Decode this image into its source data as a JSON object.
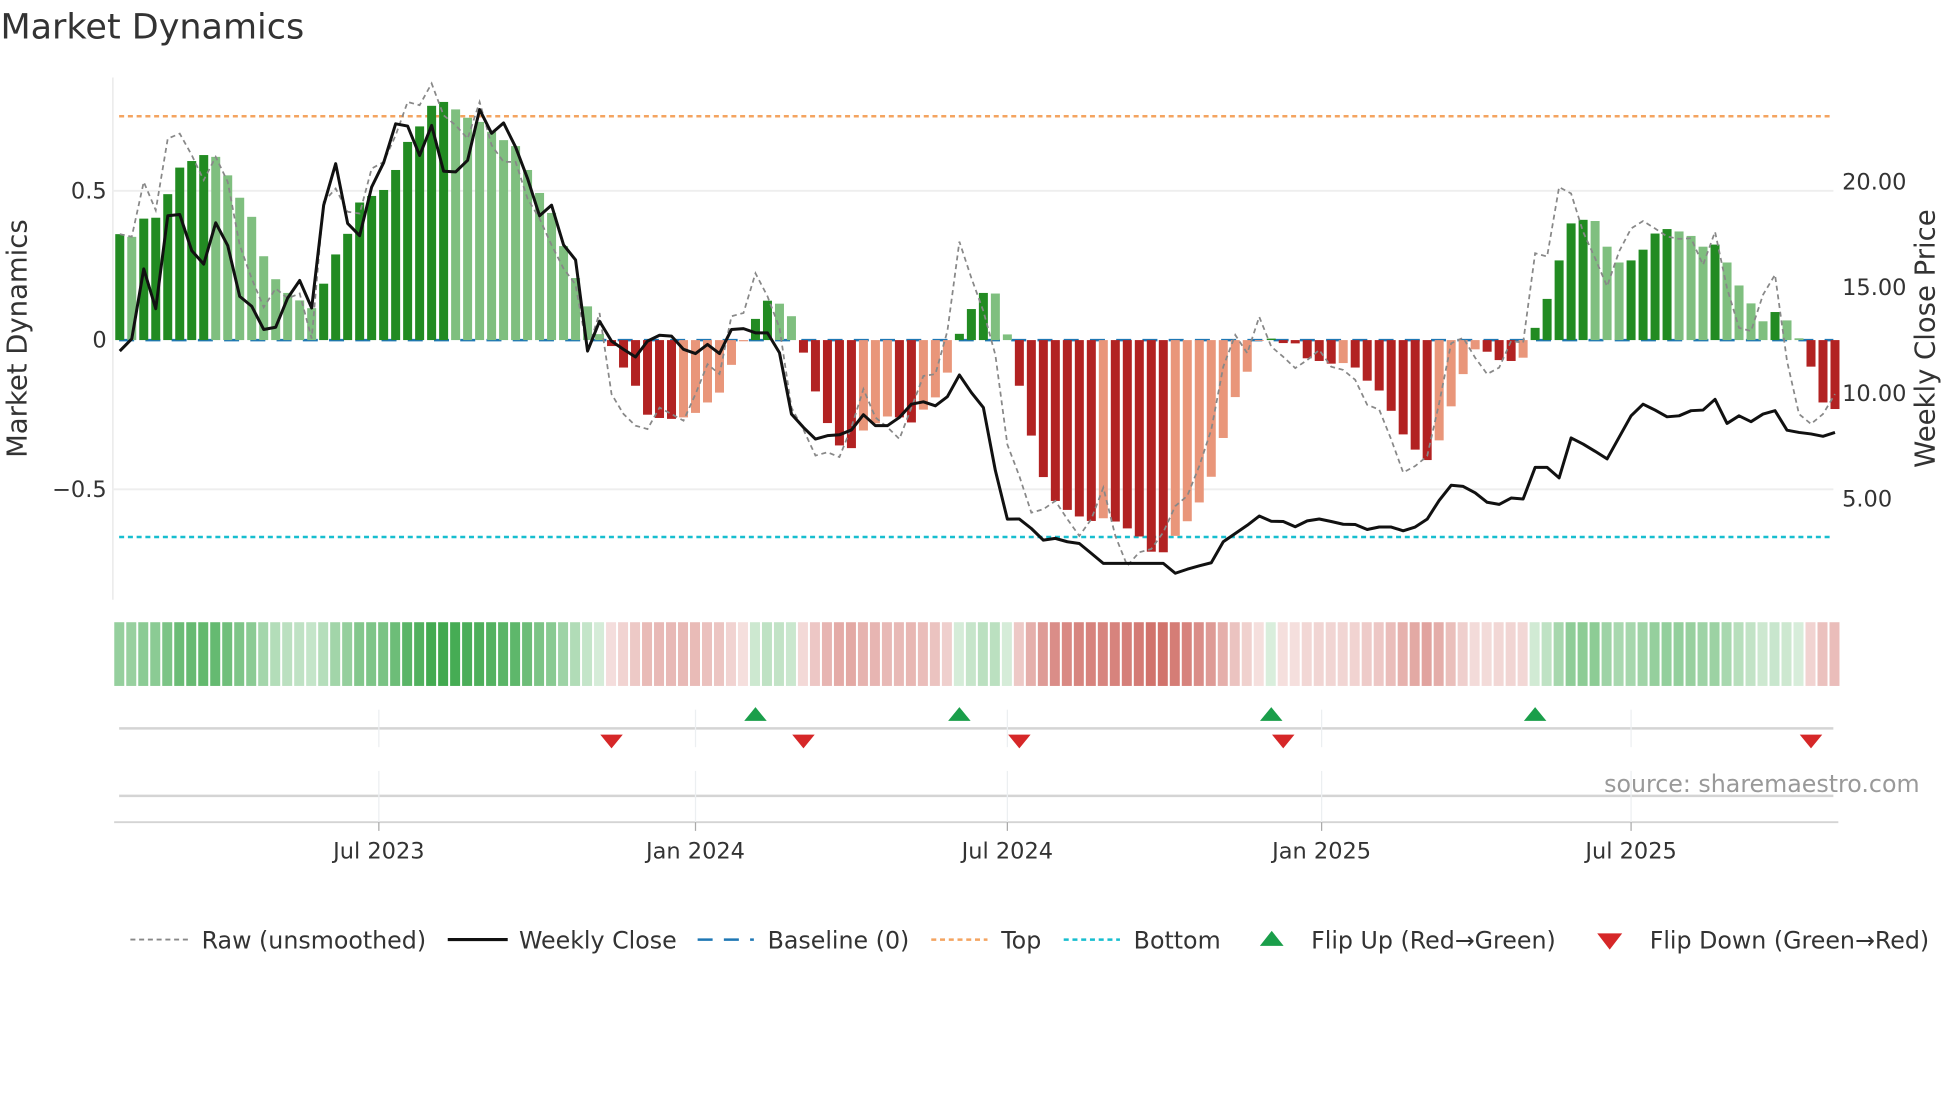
{
  "chart_data": {
    "type": "bar",
    "title": "Market Dynamics",
    "ylabel": "Market Dynamics",
    "y2label": "Weekly Close Price",
    "ylim": [
      -0.87,
      0.88
    ],
    "y2lim": [
      0.24,
      24.94
    ],
    "yticks": [
      {
        "v": 0.5,
        "label": "0.5"
      },
      {
        "v": 0,
        "label": "0"
      },
      {
        "v": -0.5,
        "label": "−0.5"
      }
    ],
    "y2ticks": [
      {
        "v": 20,
        "label": "20.00"
      },
      {
        "v": 15,
        "label": "15.00"
      },
      {
        "v": 10,
        "label": "10.00"
      },
      {
        "v": 5,
        "label": "5.00"
      }
    ],
    "xticks": [
      {
        "pos": 21.6,
        "label": "Jul 2023"
      },
      {
        "pos": 48.0,
        "label": "Jan 2024"
      },
      {
        "pos": 74.0,
        "label": "Jul 2024"
      },
      {
        "pos": 100.2,
        "label": "Jan 2025"
      },
      {
        "pos": 126.0,
        "label": "Jul 2025"
      }
    ],
    "grid": true,
    "top_level": 0.75,
    "bottom_level": -0.66,
    "baseline": 0,
    "momentum": [
      0.355,
      0.346,
      0.407,
      0.41,
      0.489,
      0.578,
      0.6,
      0.62,
      0.614,
      0.552,
      0.477,
      0.413,
      0.281,
      0.204,
      0.158,
      0.133,
      0.107,
      0.189,
      0.287,
      0.356,
      0.461,
      0.483,
      0.503,
      0.57,
      0.664,
      0.716,
      0.785,
      0.798,
      0.773,
      0.745,
      0.731,
      0.698,
      0.67,
      0.65,
      0.57,
      0.493,
      0.426,
      0.315,
      0.208,
      0.113,
      0.02,
      -0.02,
      -0.092,
      -0.153,
      -0.25,
      -0.261,
      -0.264,
      -0.259,
      -0.244,
      -0.209,
      -0.176,
      -0.083,
      -0.004,
      0.071,
      0.132,
      0.122,
      0.08,
      -0.042,
      -0.172,
      -0.278,
      -0.353,
      -0.362,
      -0.303,
      -0.279,
      -0.256,
      -0.259,
      -0.276,
      -0.233,
      -0.192,
      -0.109,
      0.021,
      0.104,
      0.158,
      0.156,
      0.019,
      -0.153,
      -0.32,
      -0.459,
      -0.539,
      -0.569,
      -0.591,
      -0.606,
      -0.597,
      -0.608,
      -0.631,
      -0.658,
      -0.709,
      -0.711,
      -0.656,
      -0.607,
      -0.544,
      -0.458,
      -0.328,
      -0.191,
      -0.106,
      -0.003,
      0.005,
      -0.01,
      -0.011,
      -0.061,
      -0.07,
      -0.079,
      -0.077,
      -0.092,
      -0.136,
      -0.169,
      -0.237,
      -0.316,
      -0.367,
      -0.402,
      -0.336,
      -0.222,
      -0.114,
      -0.031,
      -0.039,
      -0.067,
      -0.07,
      -0.059,
      0.041,
      0.138,
      0.267,
      0.391,
      0.403,
      0.399,
      0.313,
      0.26,
      0.267,
      0.303,
      0.357,
      0.372,
      0.364,
      0.349,
      0.313,
      0.32,
      0.26,
      0.183,
      0.123,
      0.063,
      0.094,
      0.066,
      0.006,
      -0.089,
      -0.209,
      -0.231
    ],
    "raw": [
      0.355,
      0.346,
      0.53,
      0.435,
      0.675,
      0.692,
      0.62,
      0.536,
      0.614,
      0.53,
      0.318,
      0.206,
      0.11,
      0.173,
      0.14,
      0.156,
      0.005,
      0.463,
      0.508,
      0.43,
      0.424,
      0.575,
      0.597,
      0.686,
      0.798,
      0.787,
      0.86,
      0.753,
      0.72,
      0.675,
      0.798,
      0.653,
      0.597,
      0.597,
      0.474,
      0.407,
      0.318,
      0.24,
      0.186,
      -0.037,
      0.091,
      -0.181,
      -0.248,
      -0.287,
      -0.298,
      -0.226,
      -0.248,
      -0.27,
      -0.181,
      -0.081,
      -0.114,
      0.08,
      0.091,
      0.224,
      0.147,
      0.041,
      -0.226,
      -0.3,
      -0.387,
      -0.376,
      -0.392,
      -0.292,
      -0.164,
      -0.259,
      -0.292,
      -0.331,
      -0.226,
      -0.12,
      -0.114,
      0.03,
      0.33,
      0.208,
      0.097,
      -0.05,
      -0.35,
      -0.456,
      -0.578,
      -0.567,
      -0.539,
      -0.6,
      -0.656,
      -0.6,
      -0.494,
      -0.656,
      -0.756,
      -0.711,
      -0.7,
      -0.644,
      -0.556,
      -0.522,
      -0.422,
      -0.3,
      -0.089,
      0.017,
      -0.044,
      0.078,
      -0.022,
      -0.056,
      -0.094,
      -0.067,
      -0.033,
      -0.089,
      -0.1,
      -0.133,
      -0.217,
      -0.233,
      -0.333,
      -0.444,
      -0.422,
      -0.389,
      -0.211,
      -0.011,
      0.008,
      -0.059,
      -0.114,
      -0.092,
      -0.003,
      -0.009,
      0.291,
      0.28,
      0.513,
      0.491,
      0.363,
      0.274,
      0.18,
      0.297,
      0.374,
      0.399,
      0.374,
      0.347,
      0.339,
      0.341,
      0.252,
      0.363,
      0.174,
      0.041,
      0.03,
      0.152,
      0.219,
      -0.07,
      -0.248,
      -0.281,
      -0.248,
      -0.181
    ],
    "close": [
      12.0,
      12.58,
      15.89,
      14.0,
      18.4,
      18.46,
      16.75,
      16.11,
      18.07,
      16.99,
      14.59,
      14.12,
      13.02,
      13.13,
      14.51,
      15.34,
      14.04,
      18.9,
      20.86,
      18.04,
      17.46,
      19.76,
      20.91,
      22.75,
      22.64,
      21.25,
      22.67,
      20.5,
      20.47,
      21.02,
      23.42,
      22.3,
      22.79,
      21.65,
      20.16,
      18.4,
      18.9,
      17.02,
      16.31,
      12.0,
      13.41,
      12.47,
      12.08,
      11.72,
      12.47,
      12.75,
      12.71,
      12.08,
      11.88,
      12.31,
      11.88,
      13.02,
      13.06,
      12.86,
      12.86,
      11.92,
      9.02,
      8.39,
      7.84,
      8.0,
      8.04,
      8.27,
      8.99,
      8.47,
      8.47,
      8.86,
      9.49,
      9.6,
      9.41,
      9.84,
      10.87,
      10.04,
      9.33,
      6.35,
      4.05,
      4.06,
      3.61,
      3.06,
      3.14,
      2.98,
      2.9,
      2.43,
      1.96,
      1.96,
      1.96,
      1.96,
      1.96,
      1.96,
      1.49,
      1.68,
      1.84,
      1.99,
      2.98,
      3.37,
      3.76,
      4.2,
      3.95,
      3.94,
      3.69,
      3.97,
      4.06,
      3.94,
      3.81,
      3.8,
      3.56,
      3.68,
      3.68,
      3.5,
      3.68,
      4.05,
      4.94,
      5.65,
      5.6,
      5.3,
      4.85,
      4.75,
      5.05,
      5.0,
      6.5,
      6.5,
      6.0,
      7.89,
      7.6,
      7.26,
      6.9,
      7.92,
      8.94,
      9.49,
      9.21,
      8.89,
      8.94,
      9.18,
      9.21,
      9.72,
      8.58,
      8.94,
      8.66,
      9.02,
      9.18,
      8.26,
      8.15,
      8.08,
      7.97,
      8.15
    ],
    "flips_up": [
      53,
      70,
      96,
      118
    ],
    "flips_down": [
      41,
      57,
      75,
      97,
      141
    ],
    "colors": {
      "pos_strong": "#228b22",
      "pos_weak": "#7fbf7f",
      "neg_strong": "#b22222",
      "neg_weak": "#e9967a",
      "raw": "#888888",
      "close": "#111111",
      "baseline": "#1f77b4",
      "top": "#f4a460",
      "bottom": "#17becf",
      "flip_up": "#1a9e4a",
      "flip_down": "#d62728"
    },
    "legend": [
      {
        "label": "Raw (unsmoothed)"
      },
      {
        "label": "Weekly Close"
      },
      {
        "label": "Baseline (0)"
      },
      {
        "label": "Top"
      },
      {
        "label": "Bottom"
      },
      {
        "label": "Flip Up (Red→Green)"
      },
      {
        "label": "Flip Down (Green→Red)"
      }
    ],
    "legend_position": "bottom",
    "source": "source: sharemaestro.com"
  }
}
